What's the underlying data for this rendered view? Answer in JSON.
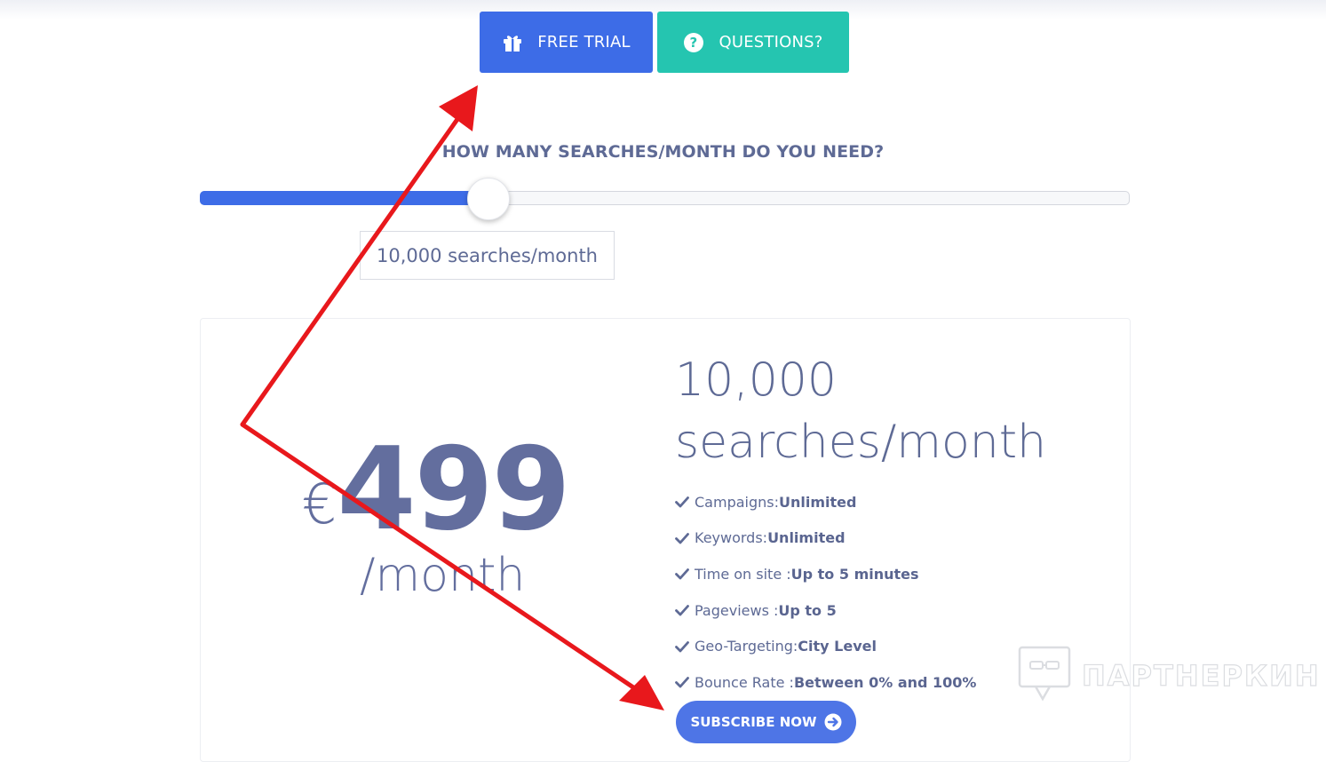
{
  "header": {
    "free_trial_label": "FREE TRIAL",
    "questions_label": "QUESTIONS?"
  },
  "slider": {
    "question": "HOW MANY SEARCHES/MONTH DO YOU NEED?",
    "value_text": "10,000 searches/month",
    "fill_fraction": 0.31
  },
  "plan": {
    "currency": "€",
    "amount": "499",
    "period": "/month",
    "title": "10,000 searches/month",
    "features": [
      {
        "label": "Campaigns: ",
        "value": "Unlimited"
      },
      {
        "label": "Keywords: ",
        "value": "Unlimited"
      },
      {
        "label": "Time on site : ",
        "value": "Up to 5 minutes"
      },
      {
        "label": "Pageviews : ",
        "value": "Up to 5"
      },
      {
        "label": "Geo-Targeting: ",
        "value": "City Level"
      },
      {
        "label": "Bounce Rate : ",
        "value": "Between 0% and 100%"
      }
    ],
    "subscribe_label": "SUBSCRIBE NOW"
  },
  "watermark": {
    "text": "ПАРТНЕРКИН"
  },
  "colors": {
    "primary": "#3d6ce7",
    "teal": "#25c5b0",
    "text": "#5e6a95",
    "annotation_arrow": "#e8181c"
  },
  "icons": {
    "free_trial": "gift-icon",
    "questions": "question-circle-icon",
    "feature": "check-icon",
    "subscribe": "arrow-circle-right-icon"
  }
}
